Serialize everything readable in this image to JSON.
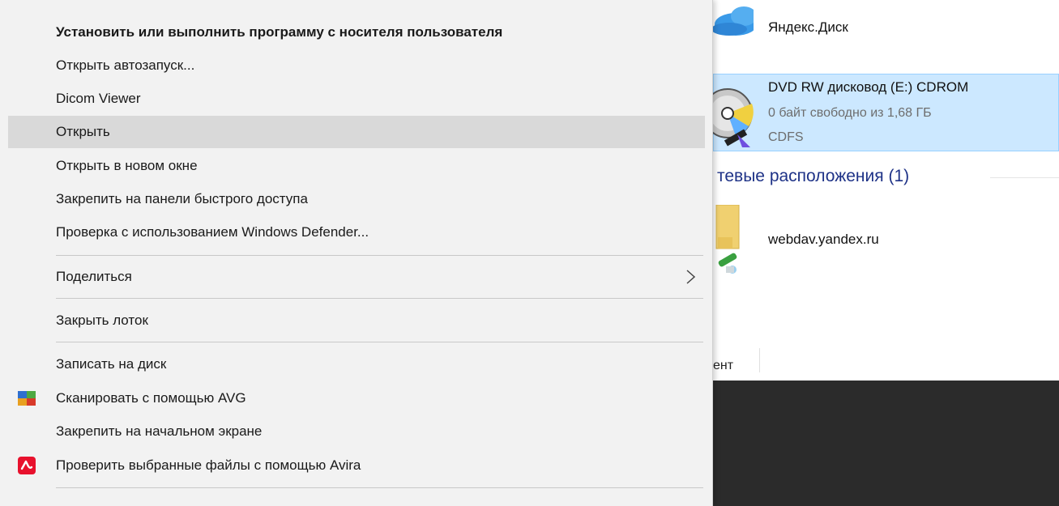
{
  "explorer": {
    "yandex_disk": {
      "label": "Яндекс.Диск",
      "icon": "cloud-icon"
    },
    "dvd_drive": {
      "name": "DVD RW дисковод (E:) CDROM",
      "free_space": "0 байт свободно из 1,68 ГБ",
      "filesystem": "CDFS",
      "icon": "cd-drive-icon"
    },
    "network_section": {
      "header": "тевые расположения (1)"
    },
    "webdav": {
      "label": "webdav.yandex.ru",
      "icon": "network-folder-icon"
    },
    "status_fragment": "ент"
  },
  "context_menu": {
    "items": [
      {
        "label": "Установить или выполнить программу с носителя пользователя",
        "bold": true
      },
      {
        "label": "Открыть автозапуск..."
      },
      {
        "label": "Dicom Viewer"
      },
      {
        "label": "Открыть",
        "highlighted": true
      },
      {
        "label": "Открыть в новом окне"
      },
      {
        "label": "Закрепить на панели быстрого доступа"
      },
      {
        "label": "Проверка с использованием Windows Defender..."
      },
      {
        "label": "Поделиться",
        "submenu": true
      },
      {
        "label": "Закрыть лоток"
      },
      {
        "label": "Записать на диск"
      },
      {
        "label": "Сканировать с помощью AVG",
        "icon": "avg-icon"
      },
      {
        "label": "Закрепить на начальном экране"
      },
      {
        "label": "Проверить выбранные файлы с помощью Avira",
        "icon": "avira-icon"
      }
    ]
  },
  "colors": {
    "menu_background": "#f2f2f2",
    "menu_highlight": "#d9d9d9",
    "selection_background": "#cce8ff",
    "selection_border": "#99d1ff",
    "section_header": "#1e3287",
    "avira_red": "#e8112d"
  }
}
